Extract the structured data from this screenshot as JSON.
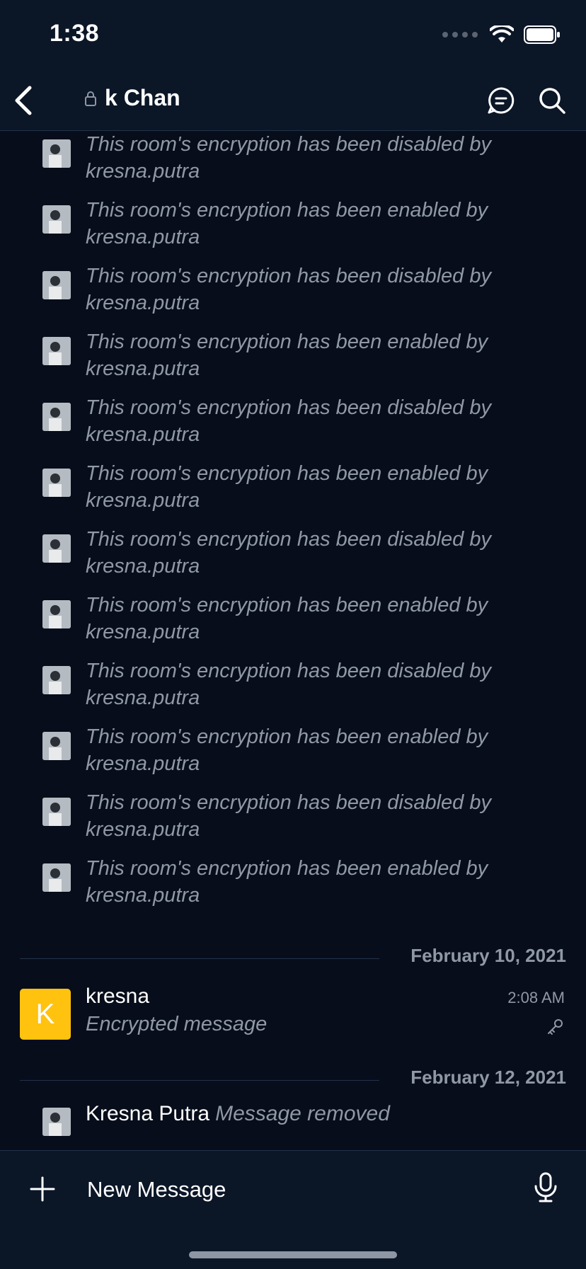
{
  "status_bar": {
    "time": "1:38"
  },
  "header": {
    "room_name": "k Chan"
  },
  "timeline": {
    "events": [
      {
        "text": "This room's encryption has been disabled by kresna.putra"
      },
      {
        "text": "This room's encryption has been enabled by kresna.putra"
      },
      {
        "text": "This room's encryption has been disabled by kresna.putra"
      },
      {
        "text": "This room's encryption has been enabled by kresna.putra"
      },
      {
        "text": "This room's encryption has been disabled by kresna.putra"
      },
      {
        "text": "This room's encryption has been enabled by kresna.putra"
      },
      {
        "text": "This room's encryption has been disabled by kresna.putra"
      },
      {
        "text": "This room's encryption has been enabled by kresna.putra"
      },
      {
        "text": "This room's encryption has been disabled by kresna.putra"
      },
      {
        "text": "This room's encryption has been enabled by kresna.putra"
      },
      {
        "text": "This room's encryption has been disabled by kresna.putra"
      },
      {
        "text": "This room's encryption has been enabled by kresna.putra"
      }
    ],
    "date_separator_1": "February 10, 2021",
    "message": {
      "avatar_letter": "K",
      "sender": "kresna",
      "body": "Encrypted message",
      "time": "2:08 AM"
    },
    "date_separator_2": "February 12, 2021",
    "removed": {
      "sender": "Kresna Putra",
      "text": "Message removed"
    }
  },
  "composer": {
    "placeholder": "New Message"
  },
  "colors": {
    "background": "#070d1a",
    "bar": "#0b1627",
    "muted": "#9098a6",
    "avatar_accent": "#ffc20e"
  }
}
